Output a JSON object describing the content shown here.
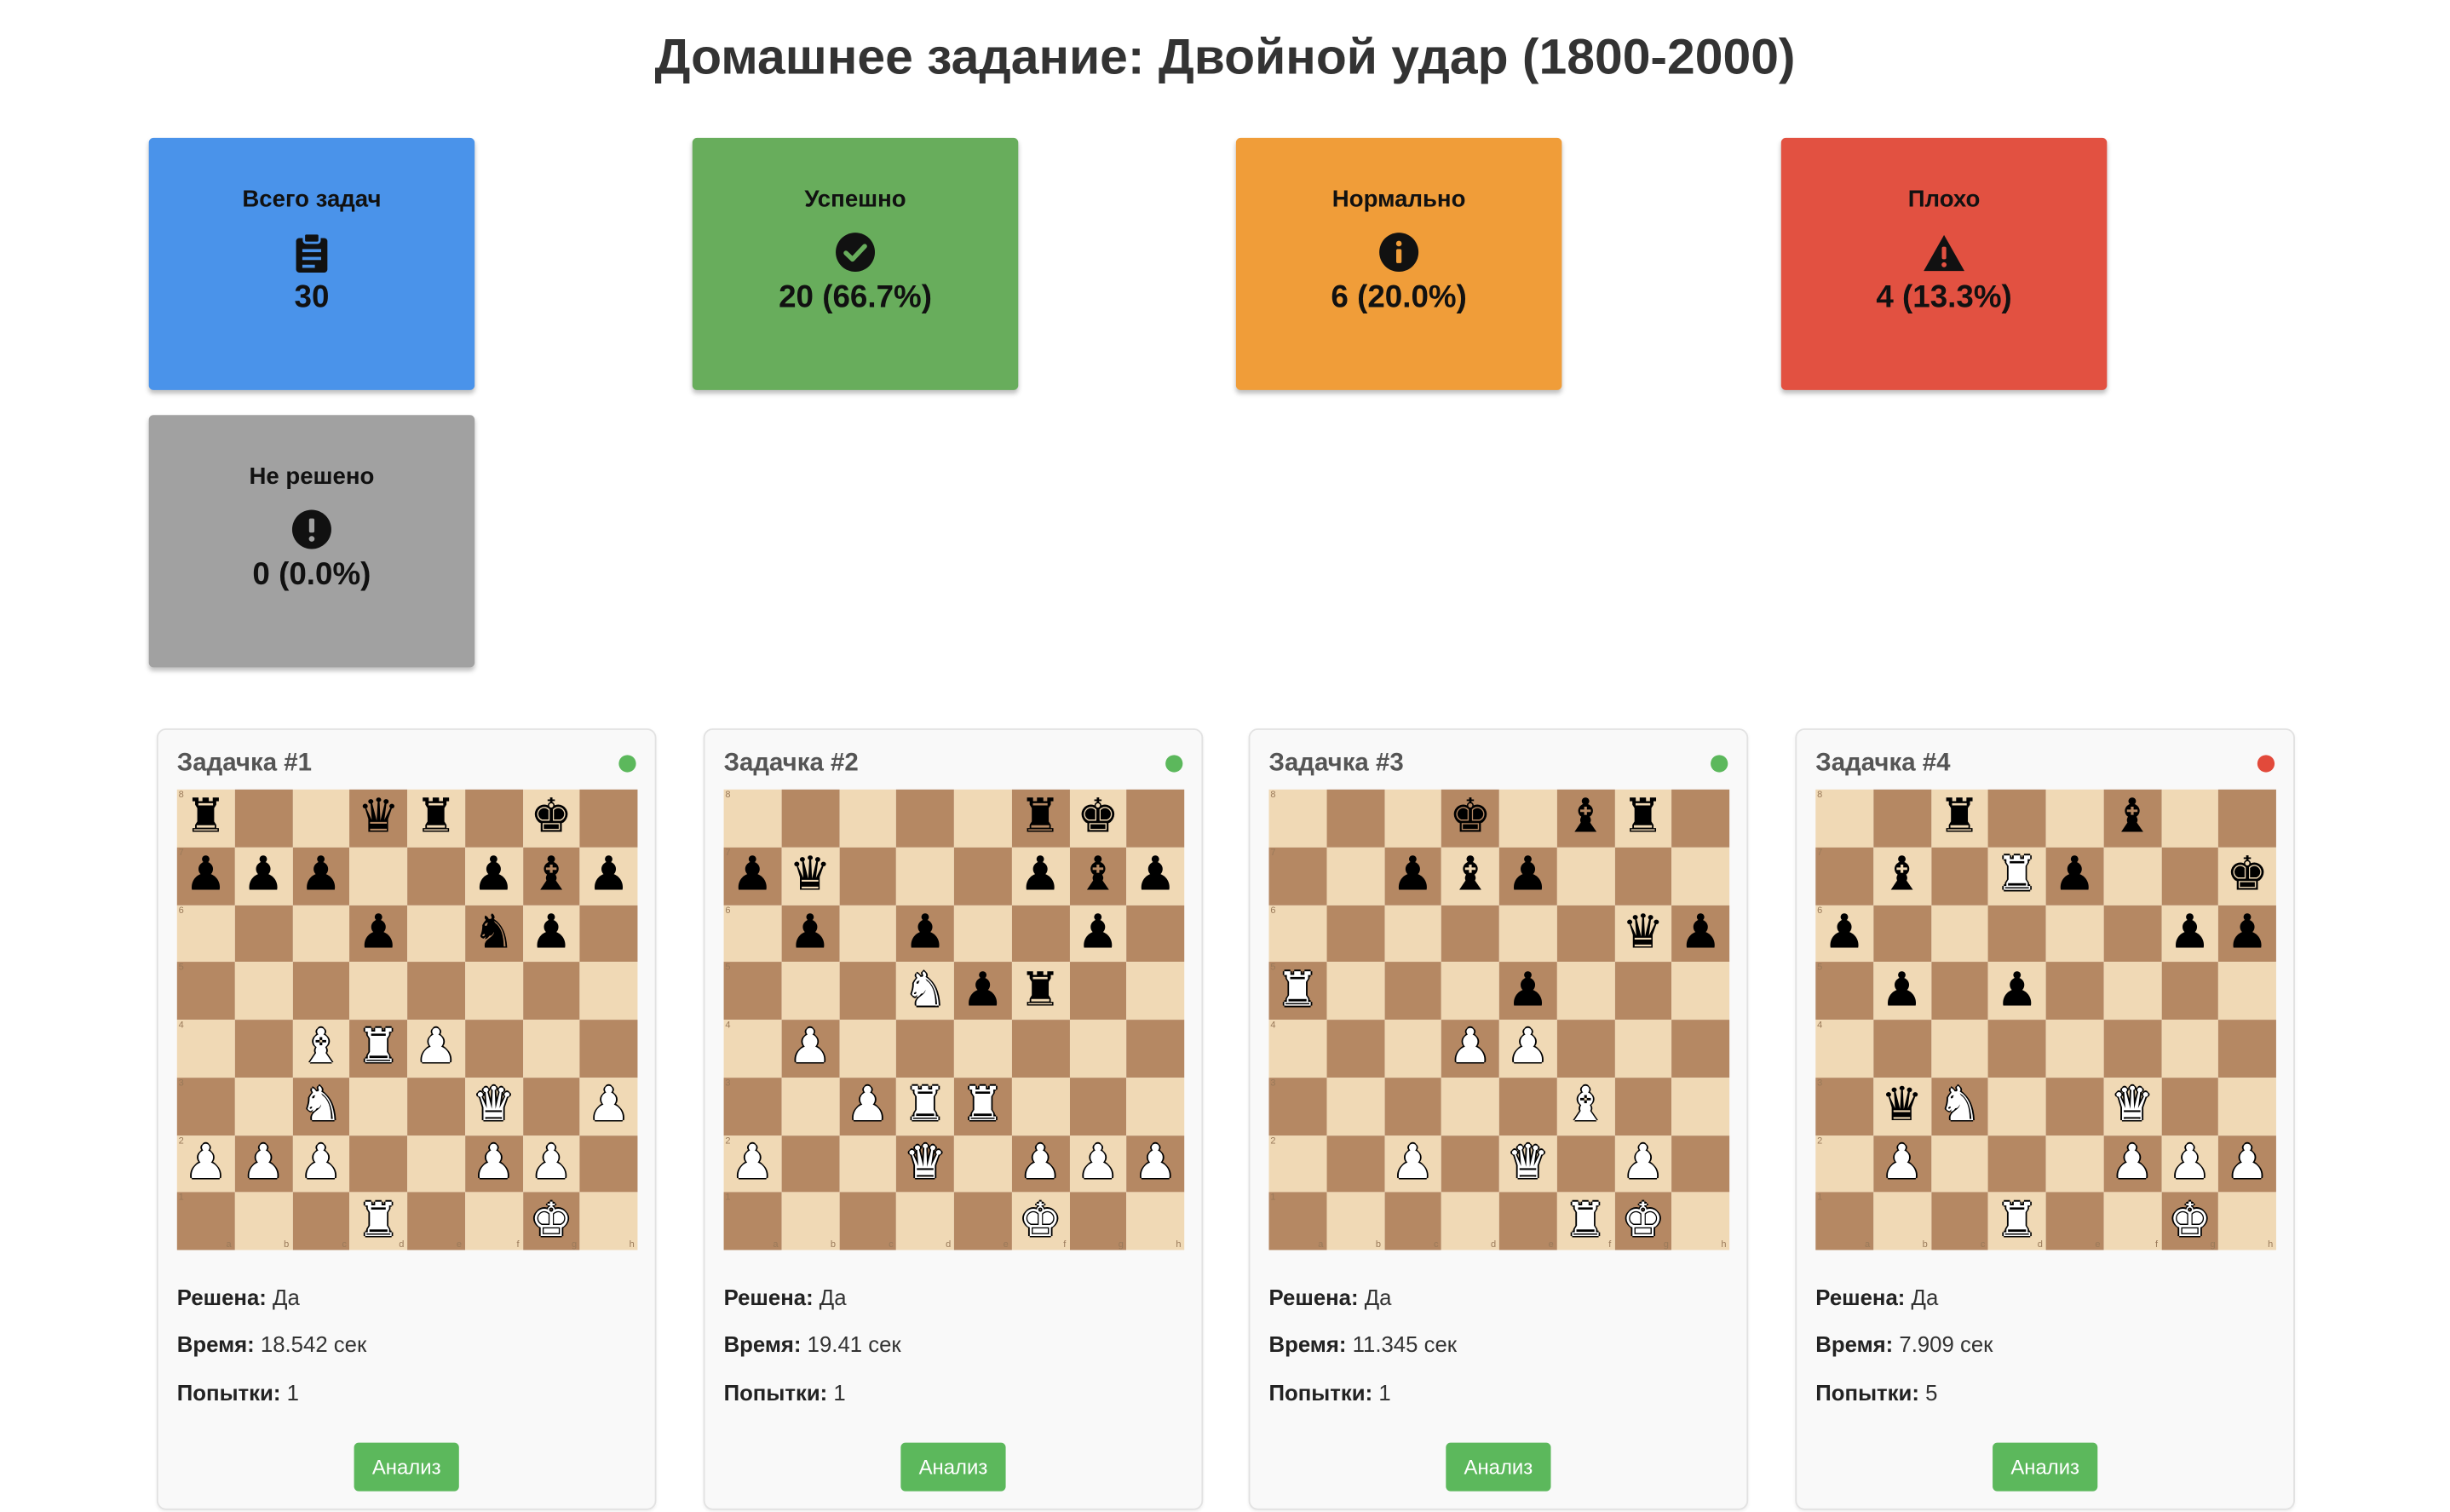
{
  "page_title": "Домашнее задание: Двойной удар (1800-2000)",
  "stats": [
    {
      "label": "Всего задач",
      "value": "30",
      "color": "#4a93ea",
      "icon": "clipboard-icon"
    },
    {
      "label": "Успешно",
      "value": "20 (66.7%)",
      "color": "#68ad5c",
      "icon": "check-circle-icon"
    },
    {
      "label": "Нормально",
      "value": "6 (20.0%)",
      "color": "#f09d39",
      "icon": "info-circle-icon"
    },
    {
      "label": "Плохо",
      "value": "4 (13.3%)",
      "color": "#e25141",
      "icon": "warning-triangle-icon"
    },
    {
      "label": "Не решено",
      "value": "0 (0.0%)",
      "color": "#a1a1a1",
      "icon": "exclamation-circle-icon"
    }
  ],
  "labels": {
    "solved": "Решена:",
    "time": "Время:",
    "attempts": "Попытки:",
    "analysis": "Анализ"
  },
  "status_colors": {
    "green": "#5cb85c",
    "red": "#e24a3b"
  },
  "tasks": [
    {
      "title": "Задачка #1",
      "status": "green",
      "solved": "Да",
      "time": "18.542 сек",
      "attempts": "1",
      "fen": "r2qr1k1/ppp2pbp/3p1np1/8/2BRP3/2N2Q1P/PPP2PP1/3R2K1"
    },
    {
      "title": "Задачка #2",
      "status": "green",
      "solved": "Да",
      "time": "19.41 сек",
      "attempts": "1",
      "fen": "5rk1/pq3pbp/1p1p2p1/3Npr2/1P6/2PRR3/P2Q1PPP/5K2"
    },
    {
      "title": "Задачка #3",
      "status": "green",
      "solved": "Да",
      "time": "11.345 сек",
      "attempts": "1",
      "fen": "3k1br1/2pbp3/6qp/R3p3/3PP3/5B2/2P1Q1P1/5RK1"
    },
    {
      "title": "Задачка #4",
      "status": "red",
      "solved": "Да",
      "time": "7.909 сек",
      "attempts": "5",
      "fen": "2r2b2/1b1Rp2k/p5pp/1p1p4/8/1qN2Q2/1P3PPP/3R2K1"
    }
  ],
  "files": [
    "a",
    "b",
    "c",
    "d",
    "e",
    "f",
    "g",
    "h"
  ],
  "ranks": [
    "8",
    "7",
    "6",
    "5",
    "4",
    "3",
    "2",
    "1"
  ]
}
